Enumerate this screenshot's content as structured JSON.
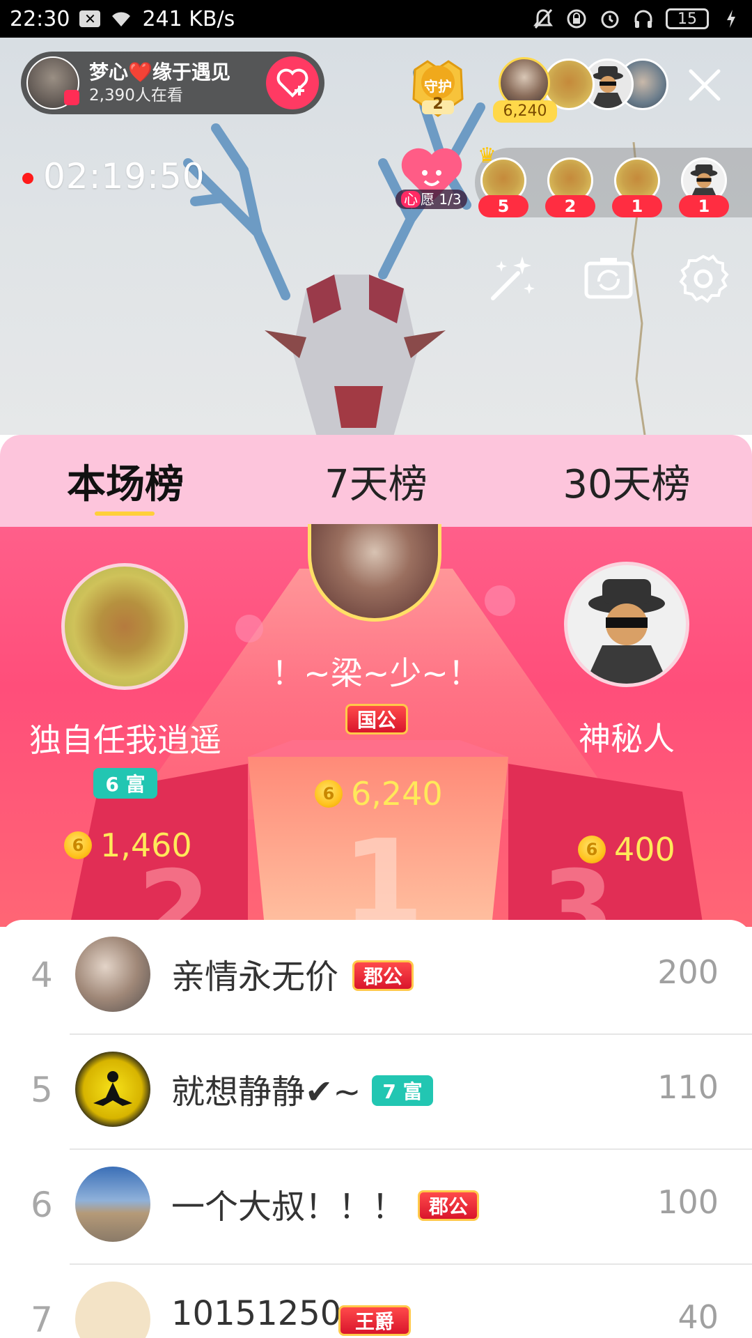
{
  "status_bar": {
    "time": "22:30",
    "speed": "241 KB/s",
    "battery": "15"
  },
  "live": {
    "host_name": "梦心❤️缘于遇见",
    "viewers": "2,390人在看",
    "guard_label": "守护",
    "guard_count": "2",
    "top_score": "6,240",
    "timer": "02:19:50",
    "wish_prefix": "心",
    "wish_text": "愿 1/3",
    "gift_counts": [
      "5",
      "2",
      "1",
      "1"
    ]
  },
  "tabs": [
    "本场榜",
    "7天榜",
    "30天榜"
  ],
  "podium": {
    "first": {
      "name": "！~梁~少~！",
      "badge": "国公",
      "score": "6,240"
    },
    "second": {
      "name": "独自任我逍遥",
      "badge": "6 富",
      "score": "1,460"
    },
    "third": {
      "name": "神秘人",
      "score": "400"
    },
    "numbers": [
      "1",
      "2",
      "3"
    ]
  },
  "list": [
    {
      "rank": "4",
      "name": "亲情永无价",
      "badge": "郡公",
      "score": "200"
    },
    {
      "rank": "5",
      "name": "就想静静✔~",
      "badge": "7 富",
      "score": "110"
    },
    {
      "rank": "6",
      "name": "一个大叔！！！",
      "badge": "郡公",
      "score": "100"
    },
    {
      "rank": "7",
      "name": "10151250",
      "badge": "王爵",
      "score": "40"
    }
  ],
  "coin_symbol": "6",
  "colors": {
    "tab_bg": "#fdc5dc",
    "podium_bg": "#ff4e7a",
    "score_yellow": "#ffe95a",
    "fortune_badge": "#22c6b2"
  }
}
